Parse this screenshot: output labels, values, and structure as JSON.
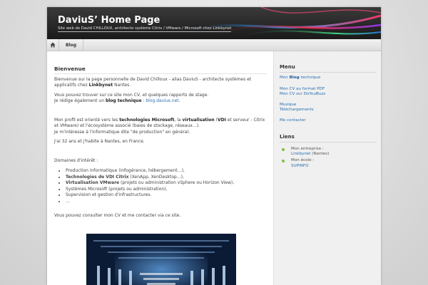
{
  "header": {
    "title": "DaviuS’ Home Page",
    "description": "Site web de David CHILLOUX, architecte système Citrix / VMware / Microsoft chez Linkbynet"
  },
  "nav": {
    "home_icon": "home-icon",
    "items": [
      "Blog"
    ]
  },
  "post": {
    "title": "Bienvenue",
    "p1_a": "Bienvenue sur la page personnelle de David Chilloux - alias DaviuS - architecte systèmes et applicatifs chez ",
    "p1_company": "Linkbynet",
    "p1_b": " Nantes.",
    "p2_line1": "Vous pouvez trouver sur ce site mon CV, et quelques rapports de stage.",
    "p2_a": "Je rédige également un ",
    "p2_blog": "blog technique",
    "p2_sep": " : ",
    "p2_url": "blog.davius.net",
    "p2_end": ".",
    "p3_a": "Mon profil est orienté vers les ",
    "p3_tech": "technologies Microsoft",
    "p3_b": ", la ",
    "p3_virt": "virtualisation",
    "p3_c": " (",
    "p3_vdi": "VDI",
    "p3_d": " et serveur - Citrix et VMware) et l'écosystème associé (baies de stockage, réseaux…).",
    "p3_line2": "Je m'intéresse à l'informatique dite \"de production\" en général.",
    "p4": "J'ai 32 ans et j'habite à Nantes, en France.",
    "p5": "Domaines d'intérêt :",
    "interests": [
      {
        "bold": "",
        "text": "Production informatique (infogérance, hébergement…),"
      },
      {
        "bold": "Technologies de VDI Citrix",
        "text": " (XenApp, XenDesktop…),"
      },
      {
        "bold": "Virtualisation VMware",
        "text": " (projets ou administration vSphere ou Horizon View),"
      },
      {
        "bold": "",
        "text": "Systèmes Microsoft (projets ou administration),"
      },
      {
        "bold": "",
        "text": "Supervision et gestion d'infrastructures."
      },
      {
        "bold": "",
        "text": "…"
      }
    ],
    "p6": "Vous pouvez consulter mon CV et me contacter via ce site."
  },
  "sidebar": {
    "menu_title": "Menu",
    "menu_blog_a": "Mon ",
    "menu_blog_b": "Blog",
    "menu_blog_c": " technique",
    "menu_cv_pdf": "Mon CV au format PDF",
    "menu_cv_doyoubuzz": "Mon CV sur DoYouBuzz",
    "menu_music": "Musique",
    "menu_downloads": "Téléchargements",
    "menu_contact": "Me contacter",
    "links_title": "Liens",
    "links": [
      {
        "label": "Mon entreprise :",
        "link": "Linkbynet",
        "suffix": " (Nantes)"
      },
      {
        "label": "Mon école :",
        "link": "SUPINFO",
        "suffix": ""
      }
    ]
  },
  "colors": {
    "link": "#2a6fb0",
    "bullet": "#7cc242",
    "header_bg": "#1a1a1a"
  }
}
